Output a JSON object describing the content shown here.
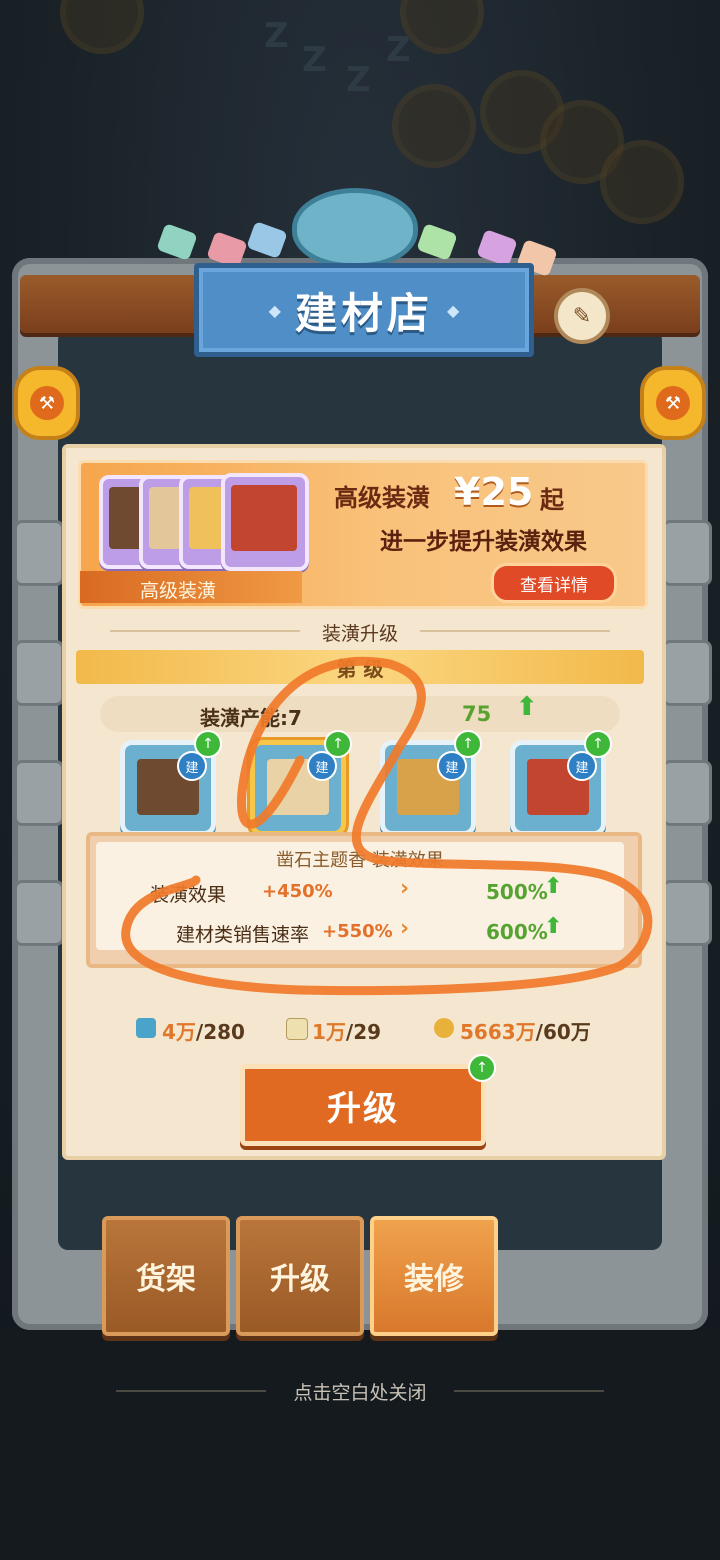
{
  "shop": {
    "title": "建材店",
    "edit_icon": "hammer-edit-icon"
  },
  "promo": {
    "title": "高级装潢",
    "price": "¥25",
    "price_suffix": "起",
    "subtitle": "进一步提升装潢效果",
    "label": "高级装潢",
    "details_button": "查看详情"
  },
  "section": {
    "title": "装潢升级",
    "level_text": "第 级 ",
    "capacity_label": "装潢产能:7",
    "capacity_next": "75"
  },
  "items": [
    {
      "badge": "建",
      "upgradable": true
    },
    {
      "badge": "建",
      "upgradable": true,
      "selected": true
    },
    {
      "badge": "建",
      "upgradable": true
    },
    {
      "badge": "建",
      "upgradable": true
    }
  ],
  "effect": {
    "title": "凿石主题香 装潢效果",
    "rows": [
      {
        "label": "装潢效果",
        "current": "+450%",
        "next": "500%"
      },
      {
        "label": "建材类销售速率",
        "current": "+550%",
        "next": "600%"
      }
    ]
  },
  "resources": [
    {
      "icon": "blueprint-icon",
      "current": "4万",
      "required": "/280"
    },
    {
      "icon": "scroll-icon",
      "current": "1万",
      "required": "/29"
    },
    {
      "icon": "coin-icon",
      "current": "5663万",
      "required": "/60万"
    }
  ],
  "upgrade_button": "升级",
  "tabs": [
    {
      "label": "货架",
      "active": false
    },
    {
      "label": "升级",
      "active": false
    },
    {
      "label": "装修",
      "active": true
    }
  ],
  "close_hint": "点击空白处关闭",
  "colors": {
    "scribble": "#f07a2a",
    "accent_orange": "#e06a22",
    "banner_blue": "#4f8ec7",
    "up_green": "#3fb83a"
  }
}
